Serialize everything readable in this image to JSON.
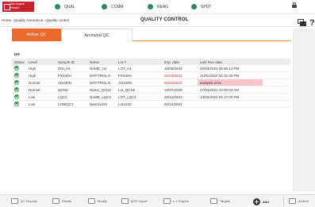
{
  "app": {
    "logo_text": "Bio-Ingelo Health"
  },
  "status_bar": {
    "items": [
      {
        "label": "QUAL",
        "color": "#2e8b57"
      },
      {
        "label": "CCMM",
        "color": "#2e8b57"
      },
      {
        "label": "REAG",
        "color": "#2e8b57"
      },
      {
        "label": "SPDT",
        "color": "#2e8b57"
      }
    ]
  },
  "breadcrumb": "Home › Quality Assurance › Quality control",
  "page_title": "QUALITY CONTROL",
  "help_symbol": "?",
  "tabs": [
    {
      "label": "Active QC",
      "active": true
    },
    {
      "label": "Archived QC",
      "active": false
    }
  ],
  "section_label": "DIF",
  "table": {
    "headers": [
      "Status",
      "Level",
      "Sample ID",
      "Name",
      "Lot #",
      "Exp. date",
      "Last Run date"
    ],
    "rows": [
      {
        "status": "ok",
        "level": "High",
        "sample_id": "DID_H1",
        "name": "NAME_H1",
        "lot": "LOT_H1",
        "exp": "15/06/2044",
        "last": "20/03/2024 05:56:14 PM",
        "exp_expired": false,
        "last_alert": false
      },
      {
        "status": "ok",
        "level": "High",
        "sample_id": "PX440H",
        "name": "DIFFTROL H",
        "lot": "PX440H",
        "exp": "01/03/2024",
        "last": "21/01/2024 04:15:40 PM",
        "exp_expired": true,
        "last_alert": false
      },
      {
        "status": "ok",
        "level": "Normal",
        "sample_id": "AD440N",
        "name": "DIFFTROL N",
        "lot": "AD440N",
        "exp": "01/03/2024",
        "last": "analysis error",
        "exp_expired": true,
        "last_alert": true
      },
      {
        "status": "ok",
        "level": "Normal",
        "sample_id": "QCN2",
        "name": "Name_QCN2",
        "lot": "Lot_QCN2",
        "exp": "12/07/2029",
        "last": "27/04/2021 10:00:04 AM",
        "exp_expired": false,
        "last_alert": false
      },
      {
        "status": "ok",
        "level": "Low",
        "sample_id": "LQC1",
        "name": "NAME_LQC1",
        "lot": "LOT_LQC1",
        "exp": "20/12/2024",
        "last": "13/02/2024 04:17:00 PM",
        "exp_expired": false,
        "last_alert": false
      },
      {
        "status": "ok",
        "level": "Low",
        "sample_id": "LOWQC1",
        "name": "Name1234",
        "lot": "Lot1234",
        "exp": "20/12/2024",
        "last": "",
        "exp_expired": false,
        "last_alert": false
      }
    ]
  },
  "toolbar": {
    "items": [
      {
        "label": "QC Reports",
        "icon": "report-icon"
      },
      {
        "label": "Details",
        "icon": "details-icon"
      },
      {
        "label": "Modify",
        "icon": "edit-icon"
      },
      {
        "label": "QCF import",
        "icon": "import-icon"
      },
      {
        "label": "L-J Graphs",
        "icon": "graph-icon"
      },
      {
        "label": "Targets",
        "icon": "target-icon"
      },
      {
        "label": "Add",
        "icon": "add-icon"
      },
      {
        "label": "Archive",
        "icon": "archive-icon"
      }
    ]
  },
  "colors": {
    "accent": "#ec6a2c",
    "ok": "#2e9c46",
    "expired": "#d9262e",
    "alert_bg": "#f6c6cc"
  }
}
